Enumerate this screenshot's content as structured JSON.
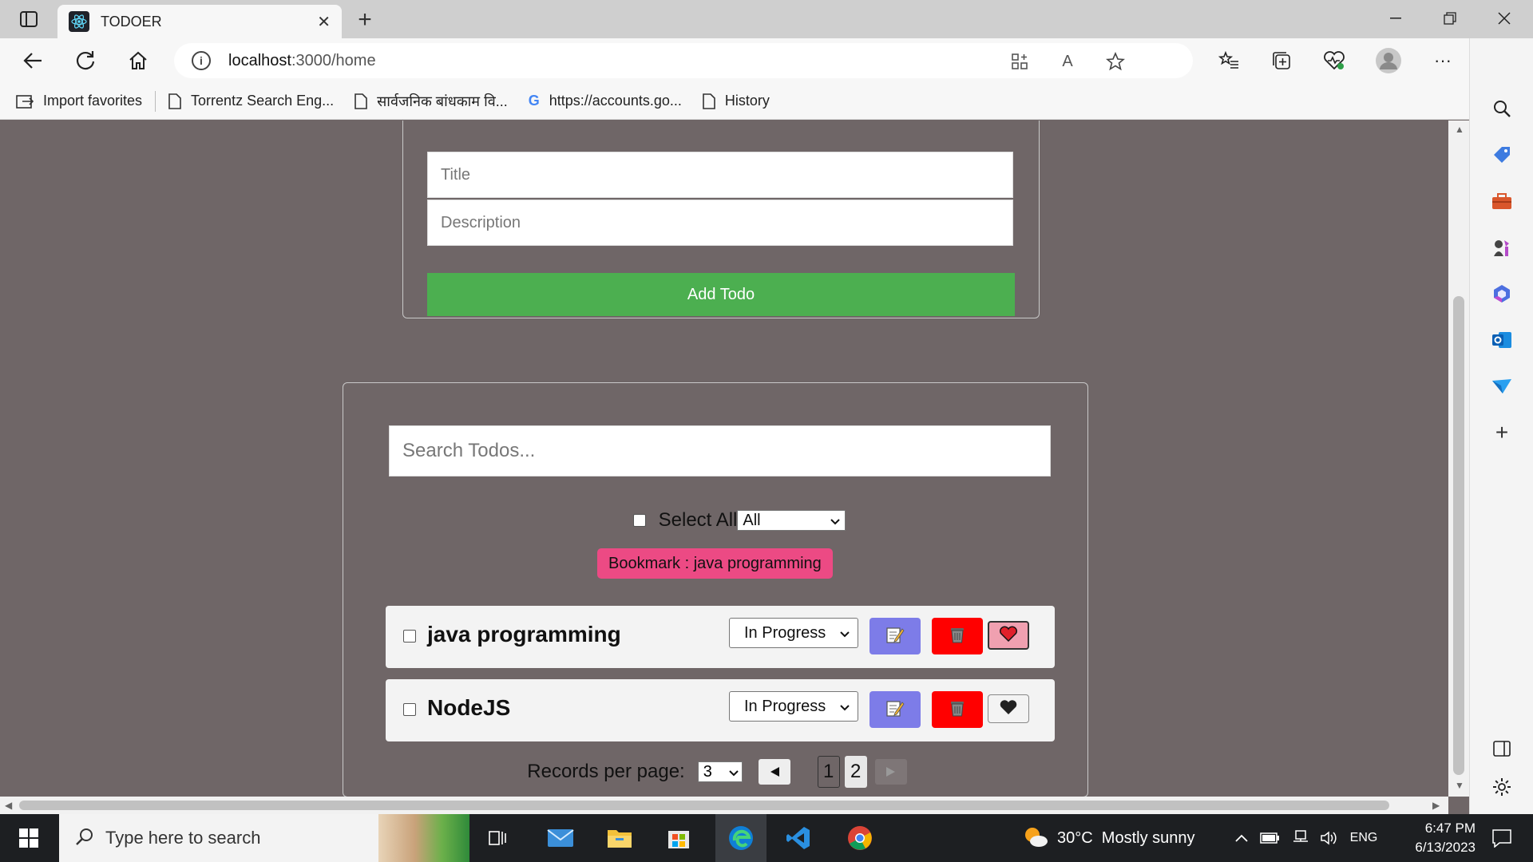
{
  "browser": {
    "tab_title": "TODOER",
    "url_host": "localhost",
    "url_path": ":3000/home",
    "read_aloud": "A",
    "bookmarks": [
      {
        "label": "Import favorites",
        "icon": "import-icon"
      },
      {
        "label": "Torrentz Search Eng...",
        "icon": "page-icon"
      },
      {
        "label": "सार्वजनिक बांधकाम वि...",
        "icon": "page-icon"
      },
      {
        "label": "https://accounts.go...",
        "icon": "google-icon"
      },
      {
        "label": "History",
        "icon": "page-icon"
      }
    ]
  },
  "add_form": {
    "title_placeholder": "Title",
    "description_placeholder": "Description",
    "add_button": "Add Todo"
  },
  "list": {
    "search_placeholder": "Search Todos...",
    "select_all_label": "Select All",
    "filter_value": "All",
    "bookmark_tag": "Bookmark : java programming",
    "todos": [
      {
        "title": "java programming",
        "status": "In Progress",
        "favorite": true
      },
      {
        "title": "NodeJS",
        "status": "In Progress",
        "favorite": false
      }
    ],
    "pagination": {
      "label": "Records per page:",
      "per_page": "3",
      "pages": [
        "1",
        "2"
      ],
      "current_page": "2"
    }
  },
  "taskbar": {
    "search_placeholder": "Type here to search",
    "weather": "30°C  Mostly sunny",
    "language": "ENG",
    "time": "6:47 PM",
    "date": "6/13/2023"
  },
  "colors": {
    "page_bg": "#6f6667",
    "add_button": "#4caf50",
    "bookmark_tag": "#ec4a84",
    "edit_button": "#7d7ce8",
    "delete_button": "#ff0000",
    "favorite_active": "#f0a0b0"
  }
}
